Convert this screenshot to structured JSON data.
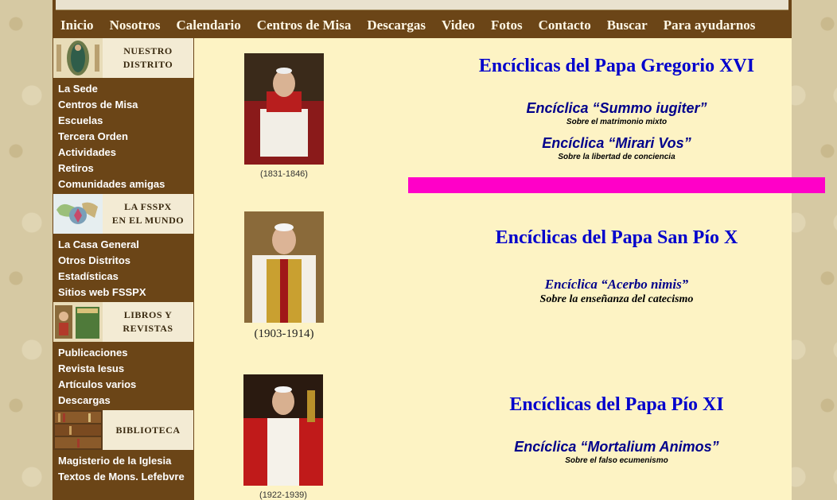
{
  "nav": [
    "Inicio",
    "Nosotros",
    "Calendario",
    "Centros de Misa",
    "Descargas",
    "Video",
    "Fotos",
    "Contacto",
    "Buscar",
    "Para ayudarnos"
  ],
  "sidebar": {
    "sections": [
      {
        "title_line1": "NUESTRO",
        "title_line2": "DISTRITO",
        "icon": "virgin-image-icon",
        "items": [
          "La Sede",
          "Centros de Misa",
          "Escuelas",
          "Tercera Orden",
          "Actividades",
          "Retiros",
          "Comunidades amigas"
        ]
      },
      {
        "title_line1": "LA FSSPX",
        "title_line2": "EN EL MUNDO",
        "icon": "world-map-icon",
        "items": [
          "La Casa General",
          "Otros Distritos",
          "Estadísticas",
          "Sitios web FSSPX"
        ]
      },
      {
        "title_line1": "LIBROS Y",
        "title_line2": "REVISTAS",
        "icon": "magazines-icon",
        "items": [
          "Publicaciones",
          "Revista Iesus",
          "Artículos varios",
          "Descargas"
        ]
      },
      {
        "title_line1": "BIBLIOTECA",
        "title_line2": "",
        "icon": "bookshelf-icon",
        "items": [
          "Magisterio de la Iglesia",
          "Textos de Mons. Lefebvre"
        ]
      }
    ]
  },
  "popes": [
    {
      "title": "Encíclicas del Papa Gregorio XVI",
      "years": "(1831-1846)",
      "encyclicals": [
        {
          "name": "Encíclica “Summo iugiter”",
          "subtitle": "Sobre el matrimonio mixto"
        },
        {
          "name": "Encíclica “Mirari Vos”",
          "subtitle": "Sobre la libertad de conciencia"
        }
      ]
    },
    {
      "title": "Encíclicas del Papa San Pío X",
      "years": "(1903-1914)",
      "encyclicals": [
        {
          "name": "Encíclica “Acerbo nimis”",
          "subtitle": "Sobre la enseñanza del catecismo"
        }
      ]
    },
    {
      "title": "Encíclicas del Papa Pío XI",
      "years": "(1922-1939)",
      "encyclicals": [
        {
          "name": "Encíclica “Mortalium Animos”",
          "subtitle": "Sobre el falso ecumenismo"
        }
      ]
    }
  ],
  "colors": {
    "brown": "#6b4517",
    "cream": "#fdf3c4",
    "title_blue": "#0000cc",
    "pink_bar": "#ff00c8"
  }
}
